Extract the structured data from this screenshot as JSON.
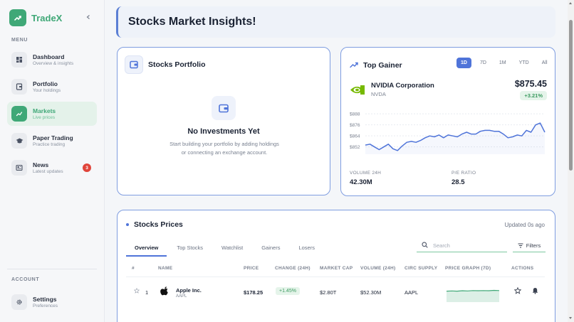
{
  "app": {
    "name": "TradeX"
  },
  "sidebar": {
    "menu_label": "MENU",
    "items": [
      {
        "title": "Dashboard",
        "subtitle": "Overview & insights",
        "icon": "grid-icon"
      },
      {
        "title": "Portfolio",
        "subtitle": "Your holdings",
        "icon": "wallet-icon"
      },
      {
        "title": "Markets",
        "subtitle": "Live prices",
        "icon": "trend-icon",
        "active": true
      },
      {
        "title": "Paper Trading",
        "subtitle": "Practice trading",
        "icon": "graduation-cap-icon"
      },
      {
        "title": "News",
        "subtitle": "Latest updates",
        "icon": "newspaper-icon",
        "badge": "3"
      }
    ],
    "account_label": "ACCOUNT",
    "account_items": [
      {
        "title": "Settings",
        "subtitle": "Preferences",
        "icon": "gear-icon"
      }
    ]
  },
  "header": {
    "title": "Stocks Market Insights!"
  },
  "portfolio_card": {
    "title": "Stocks Portfolio",
    "empty_title": "No Investments Yet",
    "empty_desc": "Start building your portfolio by adding holdings or connecting an exchange account."
  },
  "top_gainer": {
    "title": "Top Gainer",
    "ranges": [
      "1D",
      "7D",
      "1M",
      "YTD",
      "All"
    ],
    "active_range": "1D",
    "company": "NVIDIA Corporation",
    "ticker": "NVDA",
    "price": "$875.45",
    "change": "+3.21%",
    "volume_label": "VOLUME 24H",
    "volume": "42.30M",
    "pe_label": "P/E RATIO",
    "pe": "28.5"
  },
  "chart_data": {
    "type": "line",
    "title": "",
    "xlabel": "",
    "ylabel": "",
    "y_ticks": [
      "$888",
      "$876",
      "$864",
      "$852"
    ],
    "ylim": [
      844,
      892
    ],
    "x": [
      0,
      1,
      2,
      3,
      4,
      5,
      6,
      7,
      8,
      9,
      10,
      11,
      12,
      13,
      14,
      15,
      16,
      17,
      18,
      19,
      20,
      21,
      22,
      23,
      24,
      25,
      26,
      27,
      28,
      29,
      30,
      31,
      32,
      33,
      34,
      35,
      36,
      37,
      38,
      39
    ],
    "values": [
      854,
      855,
      852,
      849,
      852,
      855,
      850,
      848,
      853,
      857,
      858,
      857,
      859,
      862,
      864,
      863,
      865,
      862,
      865,
      864,
      863,
      866,
      868,
      866,
      866,
      869,
      870,
      870,
      869,
      869,
      866,
      862,
      863,
      865,
      864,
      870,
      868,
      876,
      878,
      868
    ],
    "color": "#4f74d9",
    "grid": true
  },
  "prices_card": {
    "title": "Stocks Prices",
    "updated": "Updated 0s ago",
    "tabs": [
      "Overview",
      "Top Stocks",
      "Watchlist",
      "Gainers",
      "Losers"
    ],
    "active_tab": "Overview",
    "search_placeholder": "Search",
    "filters_label": "Filters",
    "columns": [
      "#",
      "NAME",
      "PRICE",
      "CHANGE (24H)",
      "MARKET CAP",
      "VOLUME (24H)",
      "CIRC SUPPLY",
      "PRICE GRAPH (7D)",
      "ACTIONS"
    ],
    "rows": [
      {
        "rank": "1",
        "name": "Apple Inc.",
        "symbol": "AAPL",
        "price": "$178.25",
        "change": "+1.45%",
        "market_cap": "$2.80T",
        "volume": "$52.30M",
        "circ_supply": "AAPL",
        "spark": [
          0.55,
          0.56,
          0.55,
          0.57,
          0.56,
          0.58,
          0.57,
          0.58,
          0.57,
          0.59,
          0.58
        ]
      }
    ]
  },
  "colors": {
    "brand": "#3fa877",
    "accent": "#4f74d9",
    "positive": "#3b9a5f",
    "badge": "#e0453b"
  }
}
